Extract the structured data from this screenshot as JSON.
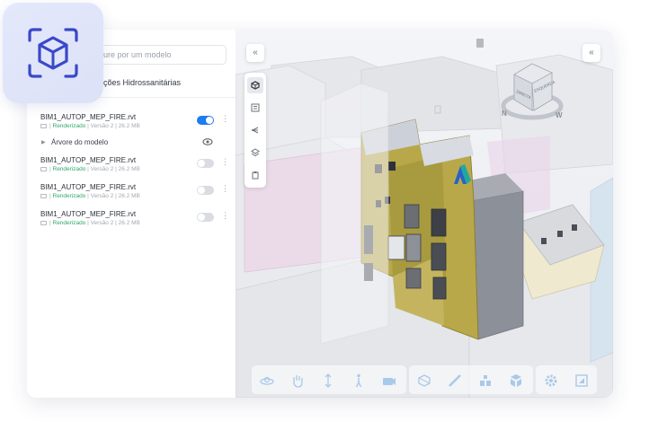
{
  "sidebar": {
    "search_placeholder": "ure por um modelo",
    "folder_title": "ções Hidrossanitárias",
    "tree_label": "Árvore do modelo",
    "files": [
      {
        "name": "BIM1_AUTOP_MEP_FIRE.rvt",
        "status": "Renderizado",
        "version": "Versão 2",
        "size": "26.2 MB",
        "enabled": true
      },
      {
        "name": "BIM1_AUTOP_MEP_FIRE.rvt",
        "status": "Renderizado",
        "version": "Versão 2",
        "size": "26.2 MB",
        "enabled": false
      },
      {
        "name": "BIM1_AUTOP_MEP_FIRE.rvt",
        "status": "Renderizado",
        "version": "Versão 2",
        "size": "26.2 MB",
        "enabled": false
      },
      {
        "name": "BIM1_AUTOP_MEP_FIRE.rvt",
        "status": "Renderizado",
        "version": "Versão 2",
        "size": "26.2 MB",
        "enabled": false
      }
    ]
  },
  "viewport": {
    "collapse_glyph": "«",
    "viewcube_faces": [
      "DIREITA",
      "ESQUERDA"
    ]
  },
  "colors": {
    "accent": "#1c7cf0",
    "success": "#2ea86b",
    "badge_icon": "#3a48c9",
    "building": "#b8a84a"
  },
  "icons": {
    "badge": "cube-scan-icon",
    "vertical_toolbar": [
      "model-icon",
      "properties-icon",
      "tree-icon",
      "layers-icon",
      "clipboard-icon"
    ],
    "bottom_toolbar": [
      "orbit-icon",
      "pan-icon",
      "zoom-icon",
      "walk-icon",
      "camera-icon",
      "section-box-icon",
      "measure-icon",
      "explode-icon",
      "model-browser-icon",
      "settings-icon",
      "fullscreen-icon"
    ]
  }
}
